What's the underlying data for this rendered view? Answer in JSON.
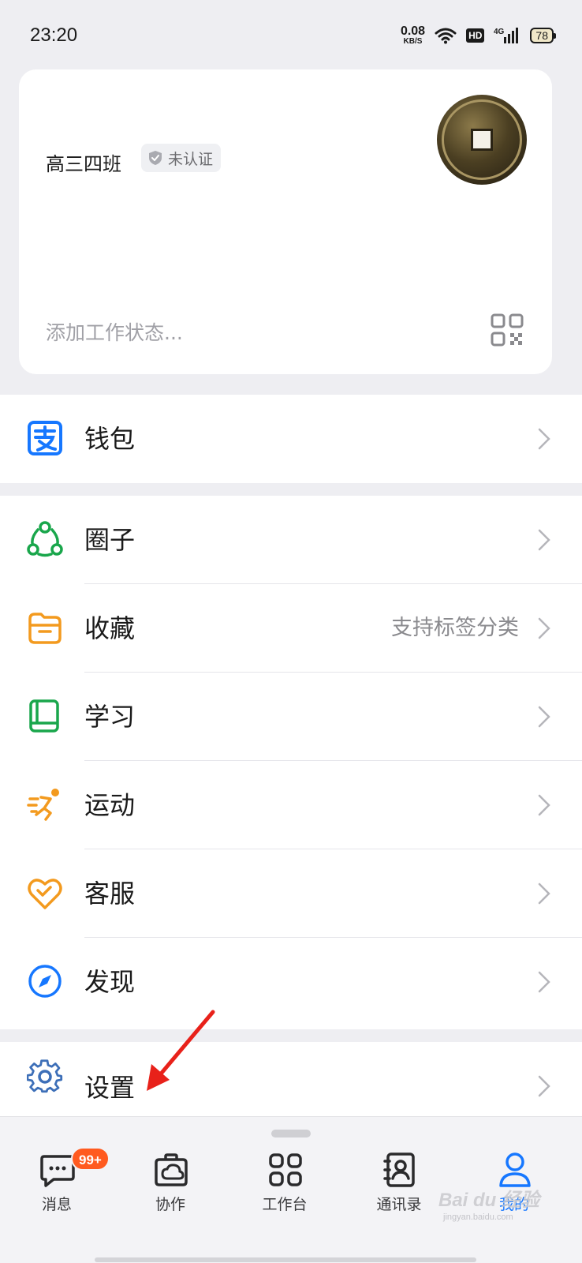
{
  "status_bar": {
    "time": "23:20",
    "net_speed_value": "0.08",
    "net_speed_unit": "KB/S",
    "hd": "HD",
    "network": "4G",
    "battery": "78"
  },
  "profile": {
    "name": "高三四班",
    "cert_status": "未认证",
    "status_placeholder": "添加工作状态..."
  },
  "menu": {
    "wallet": {
      "label": "钱包",
      "icon": "wallet-icon"
    },
    "items": [
      {
        "label": "圈子",
        "icon": "circle-group-icon",
        "extra": ""
      },
      {
        "label": "收藏",
        "icon": "folder-icon",
        "extra": "支持标签分类"
      },
      {
        "label": "学习",
        "icon": "book-icon",
        "extra": ""
      },
      {
        "label": "运动",
        "icon": "running-icon",
        "extra": ""
      },
      {
        "label": "客服",
        "icon": "heart-handshake-icon",
        "extra": ""
      },
      {
        "label": "发现",
        "icon": "compass-icon",
        "extra": ""
      }
    ],
    "settings": {
      "label": "设置",
      "icon": "gear-icon"
    }
  },
  "bottom_nav": {
    "tabs": [
      {
        "label": "消息",
        "icon": "message-icon",
        "badge": "99+"
      },
      {
        "label": "协作",
        "icon": "cowork-icon"
      },
      {
        "label": "工作台",
        "icon": "grid-icon"
      },
      {
        "label": "通讯录",
        "icon": "contacts-icon"
      },
      {
        "label": "我的",
        "icon": "person-icon",
        "active": true
      }
    ]
  },
  "watermark": {
    "text": "Bai du 经验",
    "url": "jingyan.baidu.com"
  },
  "colors": {
    "blue": "#1677ff",
    "green": "#19a64b",
    "orange": "#f39a1e",
    "badge_red": "#ff5a1f",
    "arrow_red": "#e8211a"
  }
}
